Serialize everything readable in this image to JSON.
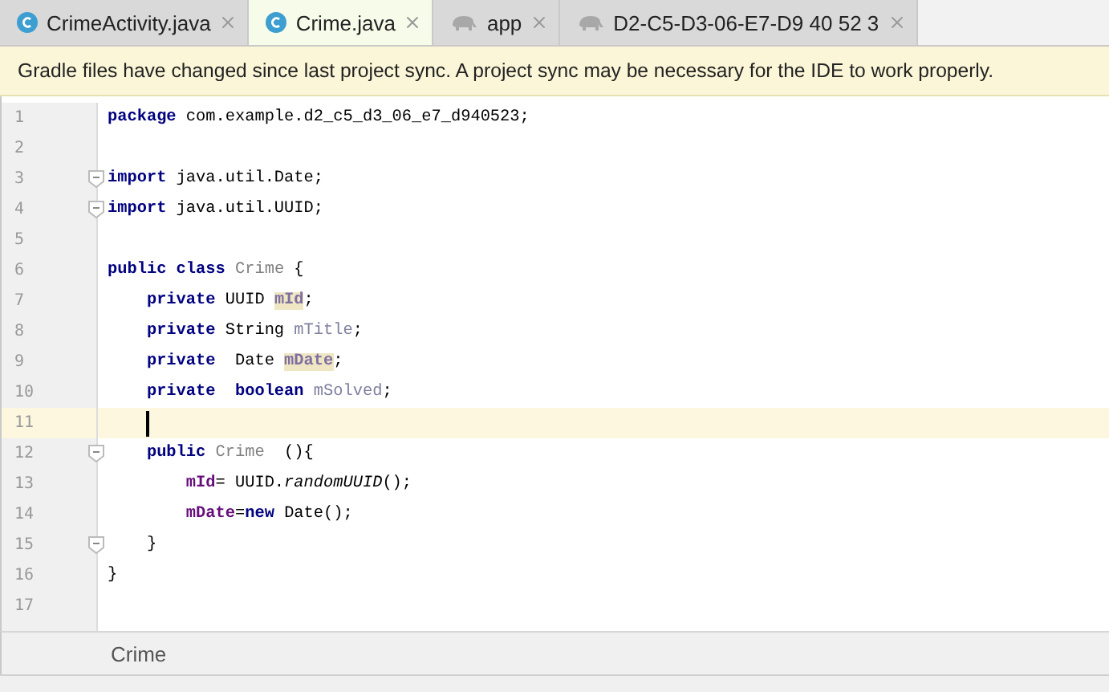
{
  "tabs": [
    {
      "label": "CrimeActivity.java",
      "kind": "class",
      "selected": false
    },
    {
      "label": "Crime.java",
      "kind": "class",
      "selected": true
    },
    {
      "label": "app",
      "kind": "gradle",
      "selected": false
    },
    {
      "label": "D2-C5-D3-06-E7-D9 40 52 3",
      "kind": "gradle",
      "selected": false
    }
  ],
  "notification": "Gradle files have changed since last project sync. A project sync may be necessary for the IDE to work properly.",
  "lines": [
    {
      "number": "1",
      "fold": false,
      "current": false,
      "tokens": [
        {
          "kind": "keyword",
          "text": "package"
        },
        {
          "kind": "text",
          "text": " com.example.d2_c5_d3_06_e7_d940523;"
        }
      ]
    },
    {
      "number": "2",
      "fold": false,
      "current": false
    },
    {
      "number": "3",
      "fold": true,
      "current": false,
      "tokens": [
        {
          "kind": "keyword",
          "text": "import"
        },
        {
          "kind": "text",
          "text": " java.util.Date;"
        }
      ]
    },
    {
      "number": "4",
      "fold": true,
      "current": false,
      "tokens": [
        {
          "kind": "keyword",
          "text": "import"
        },
        {
          "kind": "text",
          "text": " java.util.UUID;"
        }
      ]
    },
    {
      "number": "5",
      "fold": false,
      "current": false
    },
    {
      "number": "6",
      "fold": false,
      "current": false,
      "tokens": [
        {
          "kind": "keyword",
          "text": "public class"
        },
        {
          "kind": "class",
          "text": " Crime"
        },
        {
          "kind": "text",
          "text": " {"
        }
      ]
    },
    {
      "number": "7",
      "fold": false,
      "current": false,
      "tokens": [
        {
          "kind": "keyword",
          "text": "    private"
        },
        {
          "kind": "text",
          "text": " UUID "
        },
        {
          "kind": "marked",
          "text": "mId"
        },
        {
          "kind": "text",
          "text": ";"
        }
      ]
    },
    {
      "number": "8",
      "fold": false,
      "current": false,
      "tokens": [
        {
          "kind": "keyword",
          "text": "    private"
        },
        {
          "kind": "text",
          "text": " String "
        },
        {
          "kind": "field",
          "text": "mTitle"
        },
        {
          "kind": "text",
          "text": ";"
        }
      ]
    },
    {
      "number": "9",
      "fold": false,
      "current": false,
      "tokens": [
        {
          "kind": "keyword",
          "text": "    private"
        },
        {
          "kind": "text",
          "text": "  Date "
        },
        {
          "kind": "marked",
          "text": "mDate"
        },
        {
          "kind": "text",
          "text": ";"
        }
      ]
    },
    {
      "number": "10",
      "fold": false,
      "current": false,
      "tokens": [
        {
          "kind": "keyword",
          "text": "    private  boolean"
        },
        {
          "kind": "field",
          "text": " mSolved"
        },
        {
          "kind": "text",
          "text": ";"
        }
      ]
    },
    {
      "number": "11",
      "fold": false,
      "current": true
    },
    {
      "number": "12",
      "fold": true,
      "current": false,
      "tokens": [
        {
          "kind": "keyword",
          "text": "    public"
        },
        {
          "kind": "class",
          "text": " Crime "
        },
        {
          "kind": "text",
          "text": " (){"
        }
      ]
    },
    {
      "number": "13",
      "fold": false,
      "current": false,
      "tokens": [
        {
          "kind": "assigned",
          "text": "        mId"
        },
        {
          "kind": "text",
          "text": "= UUID."
        },
        {
          "kind": "italic",
          "text": "randomUUID"
        },
        {
          "kind": "text",
          "text": "();"
        }
      ]
    },
    {
      "number": "14",
      "fold": false,
      "current": false,
      "tokens": [
        {
          "kind": "assigned",
          "text": "        mDate"
        },
        {
          "kind": "text",
          "text": "="
        },
        {
          "kind": "keyword",
          "text": "new"
        },
        {
          "kind": "text",
          "text": " Date();"
        }
      ]
    },
    {
      "number": "15",
      "fold": true,
      "current": false,
      "tokens": [
        {
          "kind": "text",
          "text": "    }"
        }
      ]
    },
    {
      "number": "16",
      "fold": false,
      "current": false,
      "tokens": [
        {
          "kind": "text",
          "text": "}"
        }
      ]
    },
    {
      "number": "17",
      "fold": false,
      "current": false
    }
  ],
  "breadcrumb": "Crime"
}
